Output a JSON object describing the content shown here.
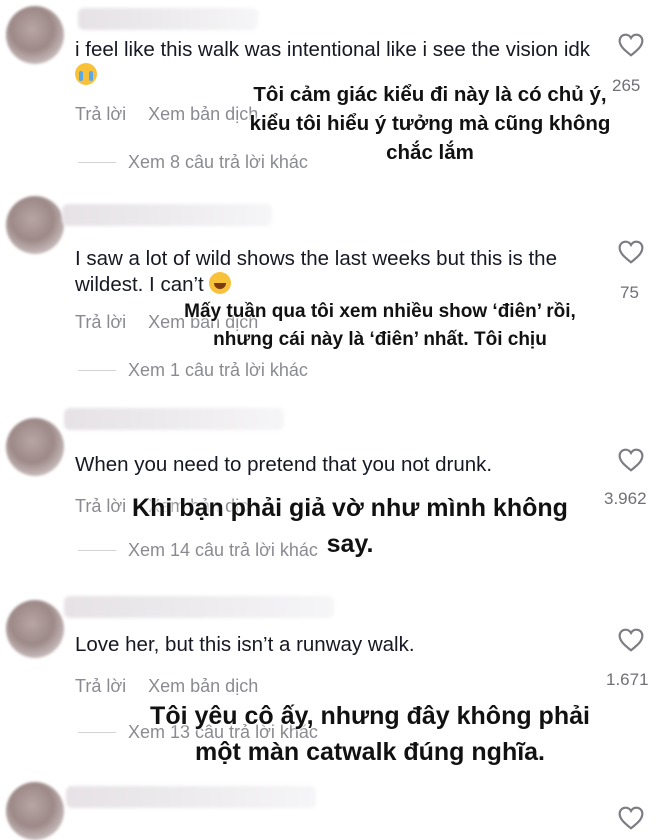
{
  "comments": [
    {
      "text": "i feel like this walk was intentional like i see the vision idk",
      "emoji": "loudly-crying-face-emoji",
      "reply_label": "Trả lời",
      "translate_label": "Xem bản dịch",
      "view_replies": "Xem 8 câu trả lời khác",
      "likes": "265",
      "translation": [
        "Tôi cảm giác kiểu đi này là có chủ ý,",
        "kiểu tôi hiểu ý tưởng mà cũng không",
        "chắc lắm"
      ]
    },
    {
      "text": "I saw a lot of wild shows the last weeks but this is the wildest. I can’t",
      "emoji": "face-with-tears-of-joy-emoji",
      "reply_label": "Trả lời",
      "translate_label": "Xem bản dịch",
      "view_replies": "Xem 1 câu trả lời khác",
      "likes": "75",
      "translation": [
        "Mấy tuần qua tôi xem nhiều show ‘điên’ rồi,",
        "nhưng cái này là ‘điên’ nhất. Tôi chịu"
      ]
    },
    {
      "text": "When you need to pretend that you not drunk.",
      "reply_label": "Trả lời",
      "translate_label": "Xem bản dịch",
      "view_replies": "Xem 14 câu trả lời khác",
      "likes": "3.962",
      "translation": [
        "Khi bạn phải giả vờ như mình không",
        "say."
      ]
    },
    {
      "text": "Love her, but this isn’t a runway walk.",
      "reply_label": "Trả lời",
      "translate_label": "Xem bản dịch",
      "view_replies": "Xem 13 câu trả lời khác",
      "likes": "1.671",
      "translation": [
        "Tôi yêu cô ấy, nhưng đây không phải",
        "một màn catwalk đúng nghĩa."
      ]
    }
  ],
  "icons": {
    "like": "heart-outline-icon"
  },
  "colors": {
    "primary_text": "#161823",
    "secondary_text": "#8a8b91",
    "overlay_text": "#111111"
  }
}
